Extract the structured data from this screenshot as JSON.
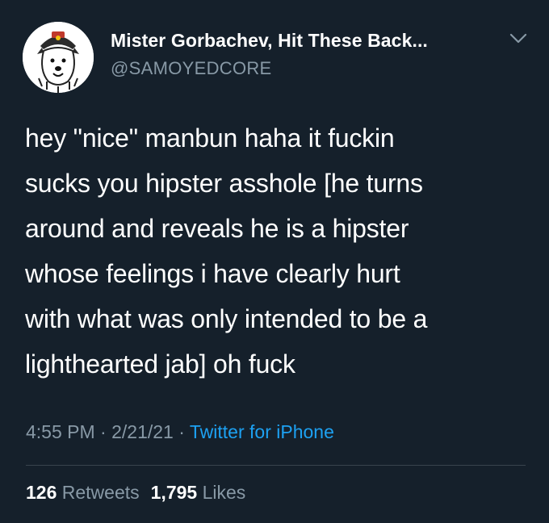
{
  "author": {
    "display_name": "Mister Gorbachev, Hit These Back...",
    "handle": "@SAMOYEDCORE",
    "avatar_icon": "samoyed-dog-with-helmet-avatar"
  },
  "tweet": {
    "lines": [
      "hey \"nice\" manbun haha it fuckin",
      "sucks you hipster asshole [he turns",
      "around and reveals he is a hipster",
      "whose feelings i have clearly hurt",
      "with what was only intended to be a",
      "lighthearted jab] oh fuck"
    ]
  },
  "meta": {
    "time": "4:55 PM",
    "separator": "·",
    "date": "2/21/21",
    "source": "Twitter for iPhone"
  },
  "stats": {
    "retweets_count": "126",
    "retweets_label": "Retweets",
    "likes_count": "1,795",
    "likes_label": "Likes"
  },
  "colors": {
    "background": "#15202b",
    "text_primary": "#ffffff",
    "text_secondary": "#8899a6",
    "link": "#1da1f2",
    "divider": "#38444d"
  },
  "icons": {
    "menu": "chevron-down-icon"
  }
}
